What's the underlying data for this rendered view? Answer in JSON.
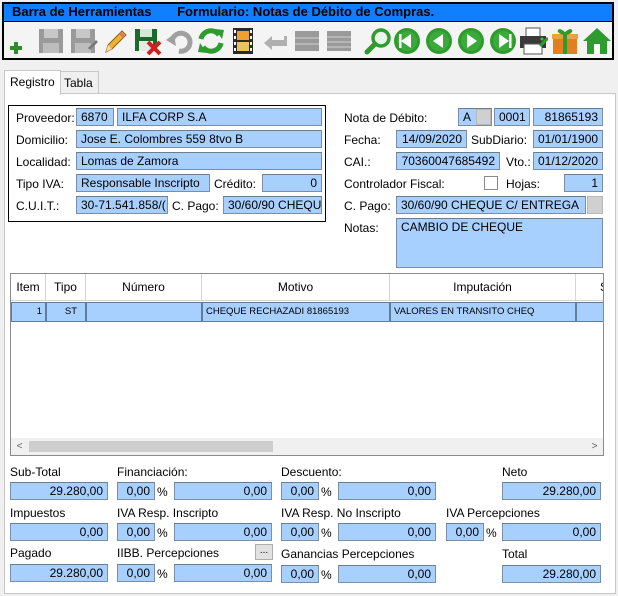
{
  "window": {
    "title_left": "Barra de Herramientas",
    "title_right": "Formulario: Notas de Débito de Compras."
  },
  "toolbar": {
    "buttons": [
      {
        "name": "add-icon",
        "color": "#2e8b2e"
      },
      {
        "name": "save-disabled-icon",
        "color": "#8c8c8c"
      },
      {
        "name": "save-as-disabled-icon",
        "color": "#8c8c8c"
      },
      {
        "name": "edit-pencil-icon",
        "color": "#e0a020"
      },
      {
        "name": "delete-save-icon",
        "color": "#d02020"
      },
      {
        "name": "undo-disabled-icon",
        "color": "#8c8c8c"
      },
      {
        "name": "refresh-icon",
        "color": "#2e9b2e"
      },
      {
        "name": "film-icon",
        "color": "#c07010"
      },
      {
        "name": "back-disabled-icon",
        "color": "#8c8c8c"
      },
      {
        "name": "grid-disabled-icon",
        "color": "#8c8c8c"
      },
      {
        "name": "list-disabled-icon",
        "color": "#8c8c8c"
      },
      {
        "name": "search-icon",
        "color": "#2e9b2e"
      },
      {
        "name": "first-record-icon",
        "color": "#2e9b2e"
      },
      {
        "name": "previous-record-icon",
        "color": "#2e9b2e"
      },
      {
        "name": "next-record-icon",
        "color": "#2e9b2e"
      },
      {
        "name": "last-record-icon",
        "color": "#2e9b2e"
      },
      {
        "name": "printer-icon",
        "color": "#3a3a3a"
      },
      {
        "name": "gift-icon",
        "color": "#e08020"
      },
      {
        "name": "home-icon",
        "color": "#2e9b2e"
      }
    ]
  },
  "tabs": {
    "registro": "Registro",
    "tabla": "Tabla"
  },
  "proveedor": {
    "label": "Proveedor:",
    "code": "6870",
    "name": "ILFA CORP S.A",
    "domicilio_label": "Domicilio:",
    "domicilio": "Jose E. Colombres 559 8tvo B",
    "localidad_label": "Localidad:",
    "localidad": "Lomas de Zamora",
    "tipo_iva_label": "Tipo IVA:",
    "tipo_iva": "Responsable Inscripto",
    "credito_label": "Crédito:",
    "credito": "0",
    "cuit_label": "C.U.I.T.:",
    "cuit": "30-71.541.858/(",
    "cpago_label": "C. Pago:",
    "cpago": "30/60/90 CHEQU"
  },
  "nota": {
    "label": "Nota de Débito:",
    "letra": "A",
    "punto": "0001",
    "numero": "81865193",
    "fecha_label": "Fecha:",
    "fecha": "14/09/2020",
    "subdiario_label": "SubDiario:",
    "subdiario": "01/01/1900",
    "cai_label": "CAI.:",
    "cai": "70360047685492",
    "vto_label": "Vto.:",
    "vto": "01/12/2020",
    "controlador_label": "Controlador Fiscal:",
    "hojas_label": "Hojas:",
    "hojas": "1",
    "cpago_label": "C. Pago:",
    "cpago": "30/60/90 CHEQUE C/ ENTREGA",
    "notas_label": "Notas:",
    "notas": "CAMBIO DE CHEQUE"
  },
  "grid": {
    "columns": [
      "Item",
      "Tipo",
      "Número",
      "Motivo",
      "Imputación",
      "S"
    ],
    "rows": [
      {
        "item": "1",
        "tipo": "ST",
        "numero": "",
        "motivo": "CHEQUE RECHAZADI 81865193",
        "imputacion": "VALORES EN TRANSITO CHEQ",
        "s": ""
      }
    ],
    "scroll_left": "<",
    "scroll_right": ">"
  },
  "totals": {
    "subtotal_label": "Sub-Total",
    "subtotal": "29.280,00",
    "financiacion_label": "Financiación:",
    "financiacion_pct": "0,00",
    "financiacion": "0,00",
    "descuento_label": "Descuento:",
    "descuento_pct": "0,00",
    "descuento": "0,00",
    "neto_label": "Neto",
    "neto": "29.280,00",
    "impuestos_label": "Impuestos",
    "impuestos": "0,00",
    "iva_ri_label": "IVA Resp. Inscripto",
    "iva_ri_pct": "0,00",
    "iva_ri": "0,00",
    "iva_rni_label": "IVA Resp. No Inscripto",
    "iva_rni_pct": "0,00",
    "iva_rni": "0,00",
    "iva_perc_label": "IVA Percepciones",
    "iva_perc_pct": "0,00",
    "iva_perc": "0,00",
    "pagado_label": "Pagado",
    "pagado": "29.280,00",
    "iibb_label": "IIBB. Percepciones",
    "iibb_btn": "...",
    "iibb_pct": "0,00",
    "iibb": "0,00",
    "ganancias_label": "Ganancias Percepciones",
    "ganancias_pct": "0,00",
    "ganancias": "0,00",
    "total_label": "Total",
    "total": "29.280,00",
    "pct_sign": "%"
  }
}
